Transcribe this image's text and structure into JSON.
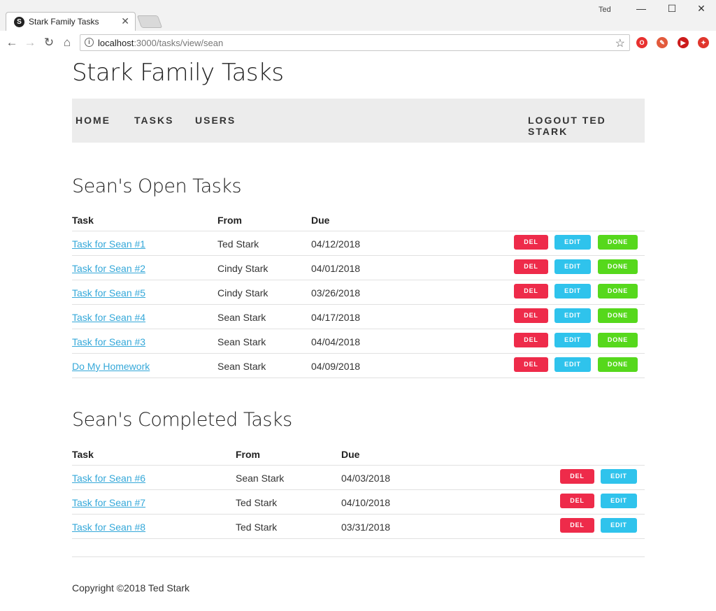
{
  "browser": {
    "tab_title": "Stark Family Tasks",
    "tab_favicon": "S",
    "profile_name": "Ted",
    "url_host": "localhost",
    "url_path": ":3000/tasks/view/sean"
  },
  "site": {
    "title": "Stark Family Tasks",
    "nav": {
      "home": "HOME",
      "tasks": "TASKS",
      "users": "USERS",
      "logout": "LOGOUT TED STARK"
    }
  },
  "open_tasks": {
    "heading": "Sean's Open Tasks",
    "columns": {
      "task": "Task",
      "from": "From",
      "due": "Due"
    },
    "buttons": {
      "del": "DEL",
      "edit": "EDIT",
      "done": "DONE"
    },
    "rows": [
      {
        "task": "Task for Sean #1",
        "from": "Ted Stark",
        "due": "04/12/2018"
      },
      {
        "task": "Task for Sean #2",
        "from": "Cindy Stark",
        "due": "04/01/2018"
      },
      {
        "task": "Task for Sean #5",
        "from": "Cindy Stark",
        "due": "03/26/2018"
      },
      {
        "task": "Task for Sean #4",
        "from": "Sean Stark",
        "due": "04/17/2018"
      },
      {
        "task": "Task for Sean #3",
        "from": "Sean Stark",
        "due": "04/04/2018"
      },
      {
        "task": "Do My Homework",
        "from": "Sean Stark",
        "due": "04/09/2018"
      }
    ]
  },
  "completed_tasks": {
    "heading": "Sean's Completed Tasks",
    "columns": {
      "task": "Task",
      "from": "From",
      "due": "Due"
    },
    "buttons": {
      "del": "DEL",
      "edit": "EDIT"
    },
    "rows": [
      {
        "task": "Task for Sean #6",
        "from": "Sean Stark",
        "due": "04/03/2018"
      },
      {
        "task": "Task for Sean #7",
        "from": "Ted Stark",
        "due": "04/10/2018"
      },
      {
        "task": "Task for Sean #8",
        "from": "Ted Stark",
        "due": "03/31/2018"
      }
    ]
  },
  "footer": {
    "copyright": "Copyright ©2018 Ted Stark"
  },
  "colors": {
    "del": "#ee2b4a",
    "edit": "#2fc3ec",
    "done": "#56d81c",
    "link": "#35a8d9",
    "navbar": "#ececec"
  }
}
